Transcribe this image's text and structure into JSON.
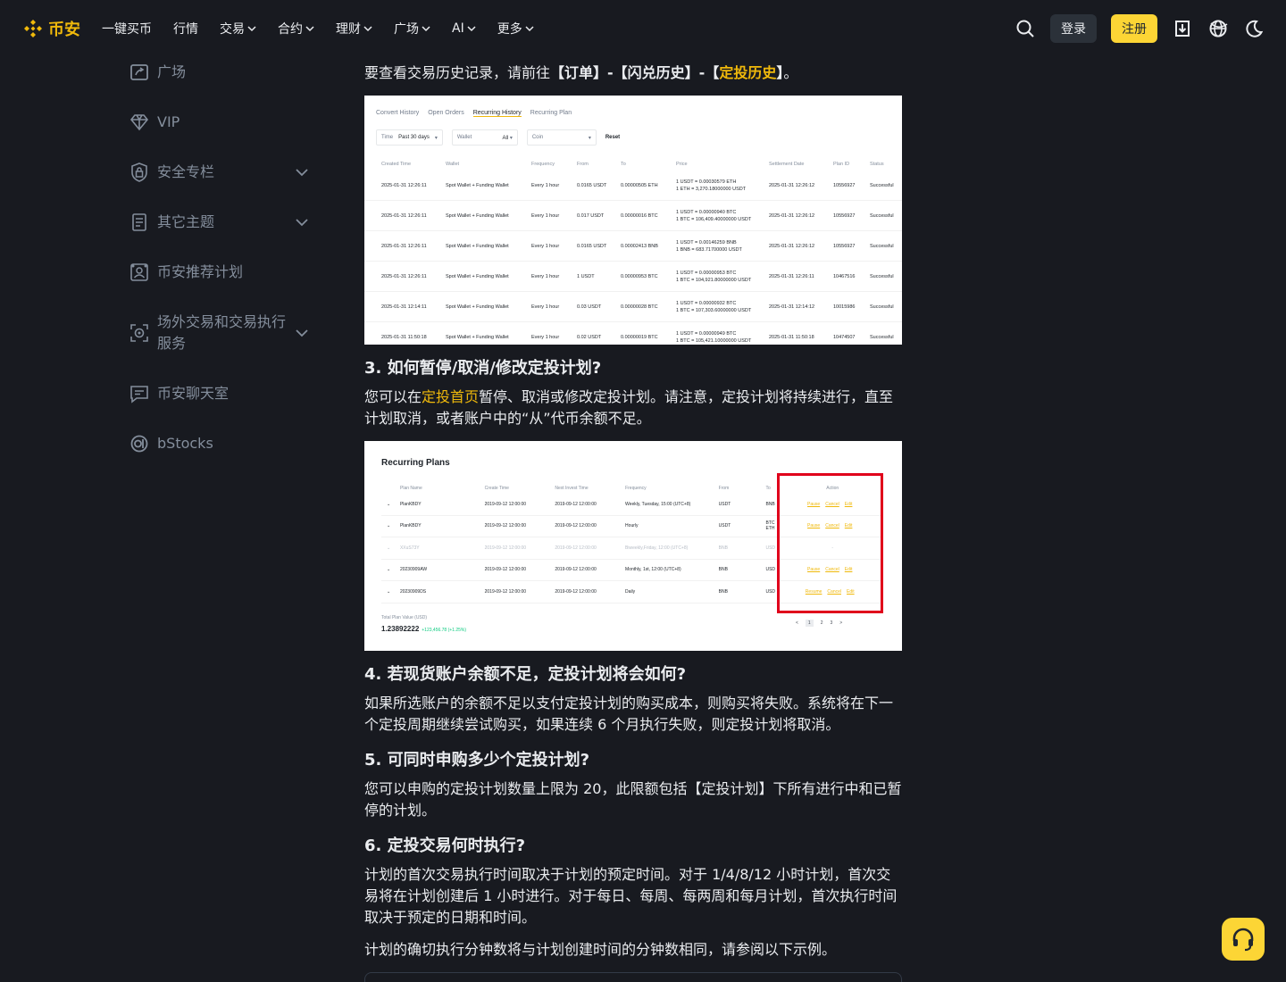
{
  "header": {
    "logo_text": "币安",
    "nav": [
      {
        "label": "一键买币",
        "has_dropdown": false
      },
      {
        "label": "行情",
        "has_dropdown": false
      },
      {
        "label": "交易",
        "has_dropdown": true
      },
      {
        "label": "合约",
        "has_dropdown": true
      },
      {
        "label": "理财",
        "has_dropdown": true
      },
      {
        "label": "广场",
        "has_dropdown": true
      },
      {
        "label": "AI",
        "has_dropdown": true
      },
      {
        "label": "更多",
        "has_dropdown": true
      }
    ],
    "login_label": "登录",
    "signup_label": "注册",
    "icons": [
      "search-icon",
      "download-icon",
      "globe-icon",
      "moon-icon"
    ]
  },
  "sidebar": {
    "items": [
      {
        "label": "广场",
        "icon": "square-icon",
        "expandable": false
      },
      {
        "label": "VIP",
        "icon": "diamond-icon",
        "expandable": false
      },
      {
        "label": "安全专栏",
        "icon": "lock-icon",
        "expandable": true
      },
      {
        "label": "其它主题",
        "icon": "document-icon",
        "expandable": true
      },
      {
        "label": "币安推荐计划",
        "icon": "referral-icon",
        "expandable": false
      },
      {
        "label": "场外交易和交易执行服务",
        "icon": "otc-icon",
        "expandable": true
      },
      {
        "label": "币安聊天室",
        "icon": "chat-icon",
        "expandable": false
      },
      {
        "label": "bStocks",
        "icon": "bstocks-icon",
        "expandable": false
      }
    ]
  },
  "article": {
    "intro_pre": "要查看交易历史记录，请前往",
    "intro_bold1": "【订单】-【闪兑历史】-【",
    "intro_link": "定投历史",
    "intro_bold2": "】",
    "intro_post": "。",
    "q3_title": "3. 如何暂停/取消/修改定投计划?",
    "q3_pre": "您可以在",
    "q3_link": "定投首页",
    "q3_post": "暂停、取消或修改定投计划。请注意，定投计划将持续进行，直至计划取消，或者账户中的“从”代币余额不足。",
    "q4_title": "4. 若现货账户余额不足，定投计划将会如何?",
    "q4_body": "如果所选账户的余额不足以支付定投计划的购买成本，则购买将失败。系统将在下一个定投周期继续尝试购买，如果连续 6 个月执行失败，则定投计划将取消。",
    "q5_title": "5. 可同时申购多少个定投计划?",
    "q5_body": "您可以申购的定投计划数量上限为 20，此限额包括【定投计划】下所有进行中和已暂停的计划。",
    "q6_title": "6. 定投交易何时执行?",
    "q6_body": "计划的首次交易执行时间取决于计划的预定时间。对于 1/4/8/12 小时计划，首次交易将在计划创建后 1 小时进行。对于每日、每周、每两周和每月计划，首次执行时间取决于预定的日期和时间。",
    "q6_body2": "计划的确切执行分钟数将与计划创建时间的分钟数相同，请参阅以下示例。"
  },
  "screenshot1": {
    "tabs": [
      "Convert History",
      "Open Orders",
      "Recurring History",
      "Recurring Plan"
    ],
    "active_tab": "Recurring History",
    "filters": {
      "time_label": "Time",
      "time_value": "Past 30 days",
      "wallet_label": "Wallet",
      "wallet_value": "All",
      "coin_label": "Coin",
      "reset": "Reset"
    },
    "columns": [
      "Created Time",
      "Wallet",
      "Frequency",
      "From",
      "To",
      "Price",
      "Settlement Date",
      "Plan ID",
      "Status"
    ],
    "rows": [
      [
        "2025-01-31 12:26:11",
        "Spot Wallet + Funding Wallet",
        "Every 1 hour",
        "0.0165 USDT",
        "0.00000505 ETH",
        "1 USDT = 0.00030579 ETH",
        "1 ETH = 3,270.18000000 USDT",
        "2025-01-31 12:26:12",
        "10556927",
        "Successful"
      ],
      [
        "2025-01-31 12:26:11",
        "Spot Wallet + Funding Wallet",
        "Every 1 hour",
        "0.017 USDT",
        "0.00000016 BTC",
        "1 USDT = 0.00000940 BTC",
        "1 BTC = 106,409.40000000 USDT",
        "2025-01-31 12:26:12",
        "10556927",
        "Successful"
      ],
      [
        "2025-01-31 12:26:11",
        "Spot Wallet + Funding Wallet",
        "Every 1 hour",
        "0.0165 USDT",
        "0.00002413 BNB",
        "1 USDT = 0.00146259 BNB",
        "1 BNB = 683.71700000 USDT",
        "2025-01-31 12:26:12",
        "10556927",
        "Successful"
      ],
      [
        "2025-01-31 12:26:11",
        "Spot Wallet + Funding Wallet",
        "Every 1 hour",
        "1 USDT",
        "0.00000953 BTC",
        "1 USDT = 0.00000953 BTC",
        "1 BTC = 104,921.80000000 USDT",
        "2025-01-31 12:26:11",
        "10467516",
        "Successful"
      ],
      [
        "2025-01-31 12:14:11",
        "Spot Wallet + Funding Wallet",
        "Every 1 hour",
        "0.03 USDT",
        "0.00000028 BTC",
        "1 USDT = 0.00000932 BTC",
        "1 BTC = 107,303.60000000 USDT",
        "2025-01-31 12:14:12",
        "10015986",
        "Successful"
      ],
      [
        "2025-01-31 11:50:18",
        "Spot Wallet + Funding Wallet",
        "Every 1 hour",
        "0.02 USDT",
        "0.00000019 BTC",
        "1 USDT = 0.00000949 BTC",
        "1 BTC = 105,421.10000000 USDT",
        "2025-01-31 11:50:18",
        "10474507",
        "Successful"
      ]
    ]
  },
  "screenshot2": {
    "title": "Recurring Plans",
    "columns": [
      "Plan Name",
      "Create Time",
      "Next Invest Time",
      "Frequency",
      "From",
      "To",
      "Action"
    ],
    "rows": [
      {
        "name": "PlanKBDY",
        "create": "2019-09-12 12:00:00",
        "next": "2019-09-12 12:00:00",
        "freq": "Weekly, Tuesday, 15:00 (UTC+8)",
        "from": "USDT",
        "to": "BNB",
        "actions": [
          "Pause",
          "Cancel",
          "Edit"
        ],
        "dim": false
      },
      {
        "name": "PlanKBDY",
        "create": "2019-09-12 12:00:00",
        "next": "2019-09-12 12:00:00",
        "freq": "Hourly",
        "from": "USDT",
        "to": "BTC ETH",
        "actions": [
          "Pause",
          "Cancel",
          "Edit"
        ],
        "dim": false
      },
      {
        "name": "XXuS73Y",
        "create": "2019-09-12 12:00:00",
        "next": "2019-09-12 12:00:00",
        "freq": "Biweekly,Friday, 12:00 (UTC+8)",
        "from": "BNB",
        "to": "USD",
        "actions": [
          "-"
        ],
        "dim": true
      },
      {
        "name": "20230909AW",
        "create": "2019-09-12 12:00:00",
        "next": "2019-09-12 12:00:00",
        "freq": "Monthly, 1st, 12:00 (UTC+8)",
        "from": "BNB",
        "to": "USD",
        "actions": [
          "Pause",
          "Cancel",
          "Edit"
        ],
        "dim": false
      },
      {
        "name": "20230909DS",
        "create": "2019-09-12 12:00:00",
        "next": "2019-09-12 12:00:00",
        "freq": "Daily",
        "from": "BNB",
        "to": "USD",
        "actions": [
          "Resume",
          "Cancel",
          "Edit"
        ],
        "dim": false
      }
    ],
    "total_label": "Total Plan Value (USD)",
    "total_value": "1.23892222",
    "total_change": "+123,456.78 (+1.25%)",
    "pages": [
      "<",
      "1",
      "2",
      "3",
      ">"
    ]
  },
  "colors": {
    "accent": "#f0b90b",
    "background": "#181a20",
    "highlight_box": "#e0001b"
  }
}
